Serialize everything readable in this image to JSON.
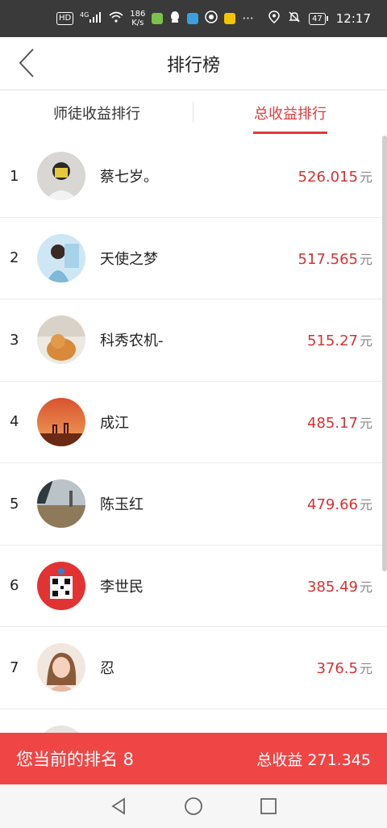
{
  "status": {
    "network": "HD",
    "signal": "4G",
    "speed": "186\nK/s",
    "battery": "47",
    "time": "12:17"
  },
  "header": {
    "title": "排行榜"
  },
  "tabs": [
    {
      "label": "师徒收益排行"
    },
    {
      "label": "总收益排行"
    }
  ],
  "rows": [
    {
      "rank": "1",
      "name": "蔡七岁。",
      "amount": "526.015",
      "unit": "元"
    },
    {
      "rank": "2",
      "name": "天使之梦",
      "amount": "517.565",
      "unit": "元"
    },
    {
      "rank": "3",
      "name": "科秀农机-",
      "amount": "515.27",
      "unit": "元"
    },
    {
      "rank": "4",
      "name": "成江",
      "amount": "485.17",
      "unit": "元"
    },
    {
      "rank": "5",
      "name": "陈玉红",
      "amount": "479.66",
      "unit": "元"
    },
    {
      "rank": "6",
      "name": "李世民",
      "amount": "385.49",
      "unit": "元"
    },
    {
      "rank": "7",
      "name": "忍",
      "amount": "376.5",
      "unit": "元"
    },
    {
      "rank": "",
      "name": "",
      "amount": "",
      "unit": ""
    }
  ],
  "footer": {
    "current_rank_label": "您当前的排名 8",
    "total_label": "总收益 271.345"
  },
  "colors": {
    "accent": "#e23b3b",
    "footer": "#f04545"
  }
}
